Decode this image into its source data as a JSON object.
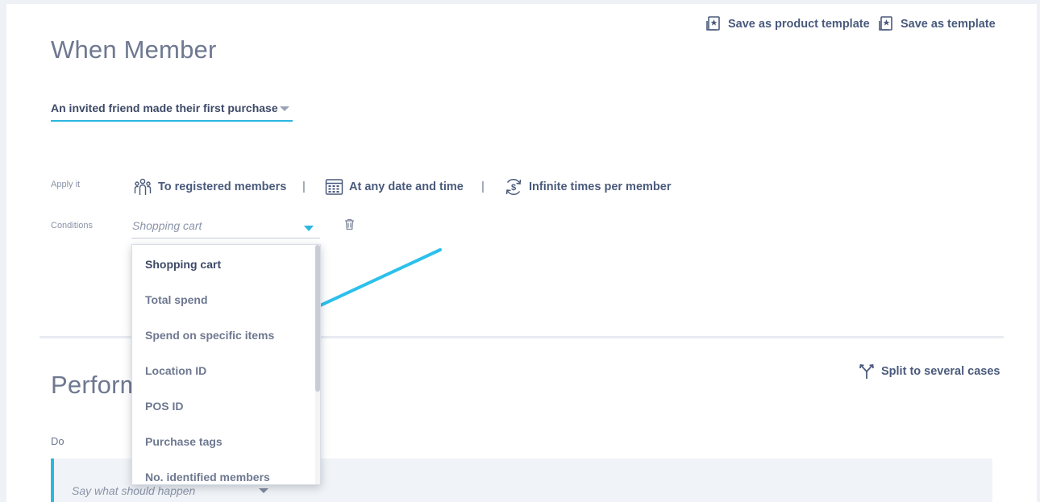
{
  "header": {
    "save_product_template": "Save as product template",
    "save_template": "Save as template"
  },
  "when_section": {
    "title": "When Member",
    "trigger_value": "An invited friend made their first purchase"
  },
  "apply": {
    "label": "Apply it",
    "items": [
      {
        "label": "To registered members",
        "icon": "members-icon"
      },
      {
        "label": "At any date and time",
        "icon": "calendar-icon"
      },
      {
        "label": "Infinite times per member",
        "icon": "repeat-dollar-icon"
      }
    ],
    "separator": "|"
  },
  "conditions": {
    "label": "Conditions",
    "selected": "Shopping cart",
    "options": [
      "Shopping cart",
      "Total spend",
      "Spend on specific items",
      "Location ID",
      "POS ID",
      "Purchase tags",
      "No. identified members"
    ]
  },
  "perform_section": {
    "title": "Perform",
    "split_label": "Split to several cases",
    "do_label": "Do",
    "do_placeholder": "Say what should happen"
  },
  "colors": {
    "accent": "#2cb6e0",
    "text_dark": "#3d4966",
    "text_link": "#4a5a7c",
    "text_muted": "#8a93a8"
  }
}
